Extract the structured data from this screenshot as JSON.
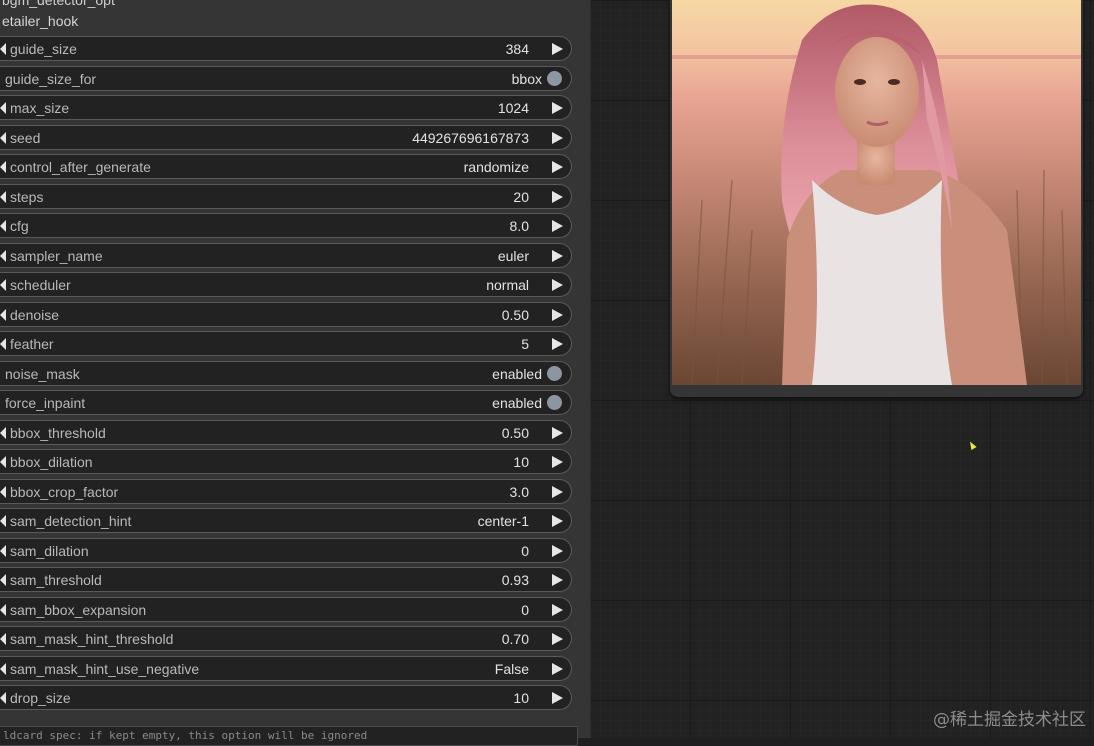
{
  "node": {
    "partial_title": "bgm_detector_opt",
    "subtitle": "etailer_hook",
    "widgets": [
      {
        "label": "guide_size",
        "value": "384",
        "kind": "number"
      },
      {
        "label": "guide_size_for",
        "value": "bbox",
        "kind": "toggle"
      },
      {
        "label": "max_size",
        "value": "1024",
        "kind": "number"
      },
      {
        "label": "seed",
        "value": "449267696167873",
        "kind": "number"
      },
      {
        "label": "control_after_generate",
        "value": "randomize",
        "kind": "combo"
      },
      {
        "label": "steps",
        "value": "20",
        "kind": "number"
      },
      {
        "label": "cfg",
        "value": "8.0",
        "kind": "number"
      },
      {
        "label": "sampler_name",
        "value": "euler",
        "kind": "combo"
      },
      {
        "label": "scheduler",
        "value": "normal",
        "kind": "combo"
      },
      {
        "label": "denoise",
        "value": "0.50",
        "kind": "number"
      },
      {
        "label": "feather",
        "value": "5",
        "kind": "number"
      },
      {
        "label": "noise_mask",
        "value": "enabled",
        "kind": "toggle"
      },
      {
        "label": "force_inpaint",
        "value": "enabled",
        "kind": "toggle"
      },
      {
        "label": "bbox_threshold",
        "value": "0.50",
        "kind": "number"
      },
      {
        "label": "bbox_dilation",
        "value": "10",
        "kind": "number"
      },
      {
        "label": "bbox_crop_factor",
        "value": "3.0",
        "kind": "number"
      },
      {
        "label": "sam_detection_hint",
        "value": "center-1",
        "kind": "combo"
      },
      {
        "label": "sam_dilation",
        "value": "0",
        "kind": "number"
      },
      {
        "label": "sam_threshold",
        "value": "0.93",
        "kind": "number"
      },
      {
        "label": "sam_bbox_expansion",
        "value": "0",
        "kind": "number"
      },
      {
        "label": "sam_mask_hint_threshold",
        "value": "0.70",
        "kind": "number"
      },
      {
        "label": "sam_mask_hint_use_negative",
        "value": "False",
        "kind": "combo"
      },
      {
        "label": "drop_size",
        "value": "10",
        "kind": "number"
      }
    ],
    "wildcard_text": "ldcard spec: if kept empty, this option will be ignored"
  },
  "watermark": "@稀土掘金技术社区",
  "colors": {
    "canvas_bg": "#222222",
    "node_bg": "#353535",
    "widget_bg": "#222222",
    "toggle_dot": "#8c96a3"
  }
}
